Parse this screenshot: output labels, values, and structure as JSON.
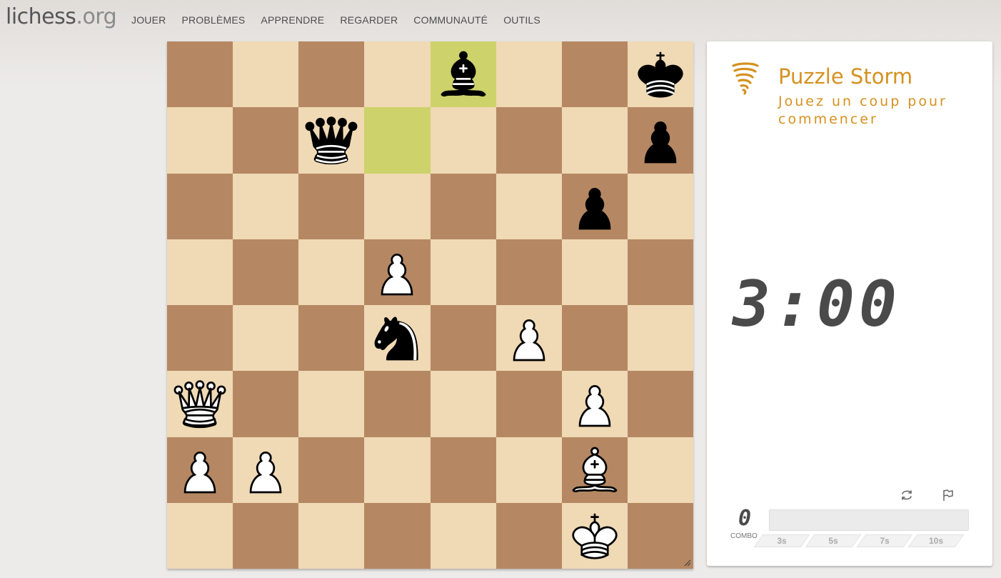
{
  "header": {
    "logo_main": "lichess",
    "logo_tld": ".org",
    "nav": [
      "JOUER",
      "PROBLÈMES",
      "APPRENDRE",
      "REGARDER",
      "COMMUNAUTÉ",
      "OUTILS"
    ]
  },
  "board": {
    "orientation": "white",
    "highlight_squares": [
      "d7",
      "e8"
    ],
    "pieces": [
      {
        "square": "e8",
        "piece": "bishop",
        "color": "black"
      },
      {
        "square": "h8",
        "piece": "king",
        "color": "black"
      },
      {
        "square": "c7",
        "piece": "queen",
        "color": "black"
      },
      {
        "square": "h7",
        "piece": "pawn",
        "color": "black"
      },
      {
        "square": "g6",
        "piece": "pawn",
        "color": "black"
      },
      {
        "square": "d5",
        "piece": "pawn",
        "color": "white"
      },
      {
        "square": "d4",
        "piece": "knight",
        "color": "black"
      },
      {
        "square": "f4",
        "piece": "pawn",
        "color": "white"
      },
      {
        "square": "a3",
        "piece": "queen",
        "color": "white"
      },
      {
        "square": "g3",
        "piece": "pawn",
        "color": "white"
      },
      {
        "square": "a2",
        "piece": "pawn",
        "color": "white"
      },
      {
        "square": "b2",
        "piece": "pawn",
        "color": "white"
      },
      {
        "square": "g2",
        "piece": "bishop",
        "color": "white"
      },
      {
        "square": "g1",
        "piece": "king",
        "color": "white"
      }
    ],
    "colors": {
      "light": "#f0d9b5",
      "dark": "#b58863",
      "highlight": "#cdd26a"
    }
  },
  "storm": {
    "icon": "tornado-icon",
    "title": "Puzzle Storm",
    "subtitle": "Jouez un coup pour commencer",
    "clock": "3:00",
    "combo_value": "0",
    "combo_label": "COMBO",
    "combo_levels": [
      "3s",
      "5s",
      "7s",
      "10s"
    ],
    "accent_color": "#d59120"
  },
  "controls": {
    "flip_icon": "flip-board-icon",
    "resign_icon": "flag-icon"
  }
}
